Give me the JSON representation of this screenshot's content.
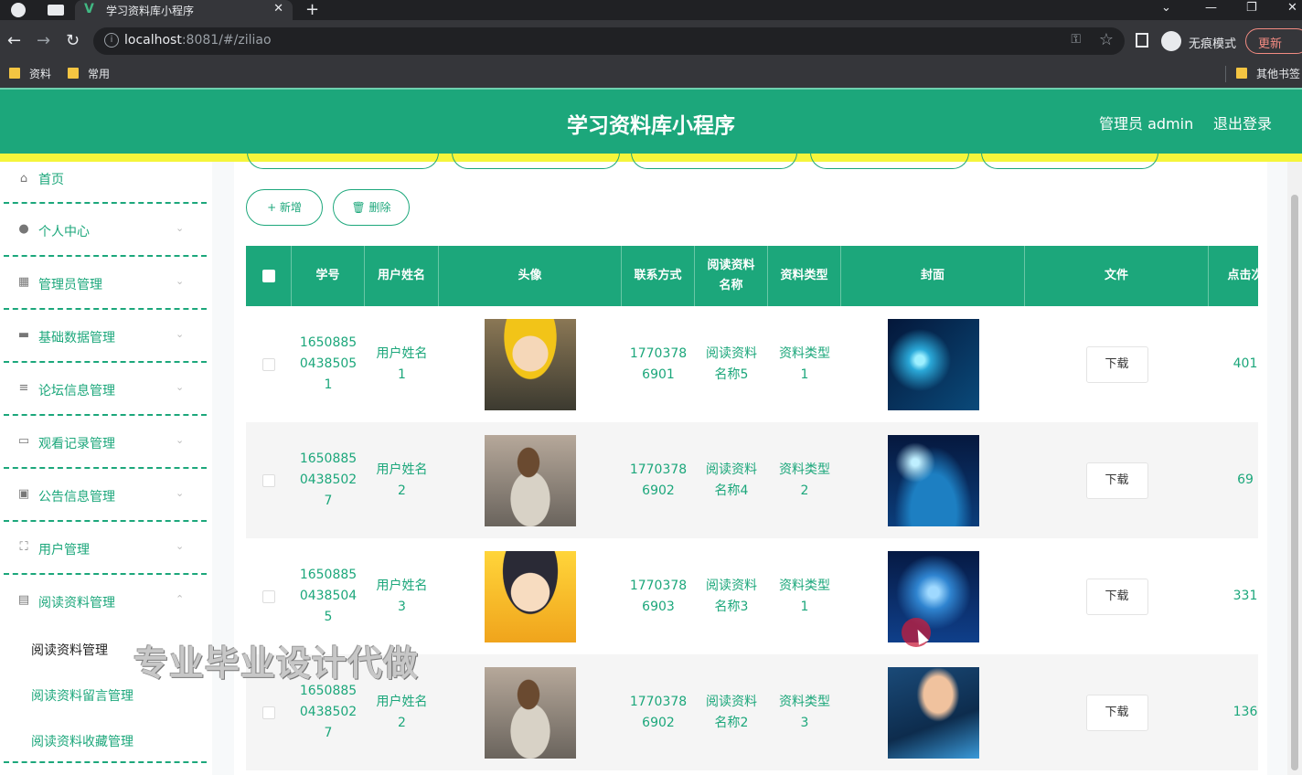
{
  "browser": {
    "tab_title": "学习资料库小程序",
    "url_host": "localhost",
    "url_rest": ":8081/#/ziliao",
    "incognito_label": "无痕模式",
    "update_label": "更新",
    "bookmarks": [
      "资料",
      "常用"
    ],
    "other_bookmarks": "其他书签"
  },
  "header": {
    "title": "学习资料库小程序",
    "user": "管理员 admin",
    "logout": "退出登录"
  },
  "sidebar": {
    "items": [
      {
        "label": "首页",
        "icon": "home-icon"
      },
      {
        "label": "个人中心",
        "icon": "user-icon"
      },
      {
        "label": "管理员管理",
        "icon": "chart-icon"
      },
      {
        "label": "基础数据管理",
        "icon": "chat-icon"
      },
      {
        "label": "论坛信息管理",
        "icon": "sliders-icon"
      },
      {
        "label": "观看记录管理",
        "icon": "briefcase-icon"
      },
      {
        "label": "公告信息管理",
        "icon": "document-icon"
      },
      {
        "label": "用户管理",
        "icon": "fullscreen-icon"
      },
      {
        "label": "阅读资料管理",
        "icon": "list-icon"
      }
    ],
    "sub_items": [
      "阅读资料管理",
      "阅读资料留言管理",
      "阅读资料收藏管理"
    ]
  },
  "toolbar": {
    "add_label": "+ 新增",
    "delete_label": "🗑 删除"
  },
  "table": {
    "headers": [
      "学号",
      "用户姓名",
      "头像",
      "联系方式",
      "阅读资料名称",
      "资料类型",
      "封面",
      "文件",
      "点击次"
    ],
    "download_label": "下载",
    "rows": [
      {
        "student_no": "16508850438505 1",
        "no_lines": [
          "1650885",
          "0438505",
          "1"
        ],
        "name_lines": [
          "用户姓名",
          "1"
        ],
        "phone_lines": [
          "1770378",
          "6901"
        ],
        "title_lines": [
          "阅读资料",
          "名称5"
        ],
        "type_lines": [
          "资料类型",
          "1"
        ],
        "clicks": "401"
      },
      {
        "student_no": "16508850438502 7",
        "no_lines": [
          "1650885",
          "0438502",
          "7"
        ],
        "name_lines": [
          "用户姓名",
          "2"
        ],
        "phone_lines": [
          "1770378",
          "6902"
        ],
        "title_lines": [
          "阅读资料",
          "名称4"
        ],
        "type_lines": [
          "资料类型",
          "2"
        ],
        "clicks": "69"
      },
      {
        "student_no": "16508850438504 5",
        "no_lines": [
          "1650885",
          "0438504",
          "5"
        ],
        "name_lines": [
          "用户姓名",
          "3"
        ],
        "phone_lines": [
          "1770378",
          "6903"
        ],
        "title_lines": [
          "阅读资料",
          "名称3"
        ],
        "type_lines": [
          "资料类型",
          "1"
        ],
        "clicks": "331"
      },
      {
        "student_no": "16508850438502 7",
        "no_lines": [
          "1650885",
          "0438502",
          "7"
        ],
        "name_lines": [
          "用户姓名",
          "2"
        ],
        "phone_lines": [
          "1770378",
          "6902"
        ],
        "title_lines": [
          "阅读资料",
          "名称2"
        ],
        "type_lines": [
          "资料类型",
          "3"
        ],
        "clicks": "136"
      }
    ]
  },
  "watermark": "专业毕业设计代做",
  "colors": {
    "primary": "#1ca77b",
    "accent_strip": "#f5f53b",
    "chrome_dark": "#202124"
  }
}
